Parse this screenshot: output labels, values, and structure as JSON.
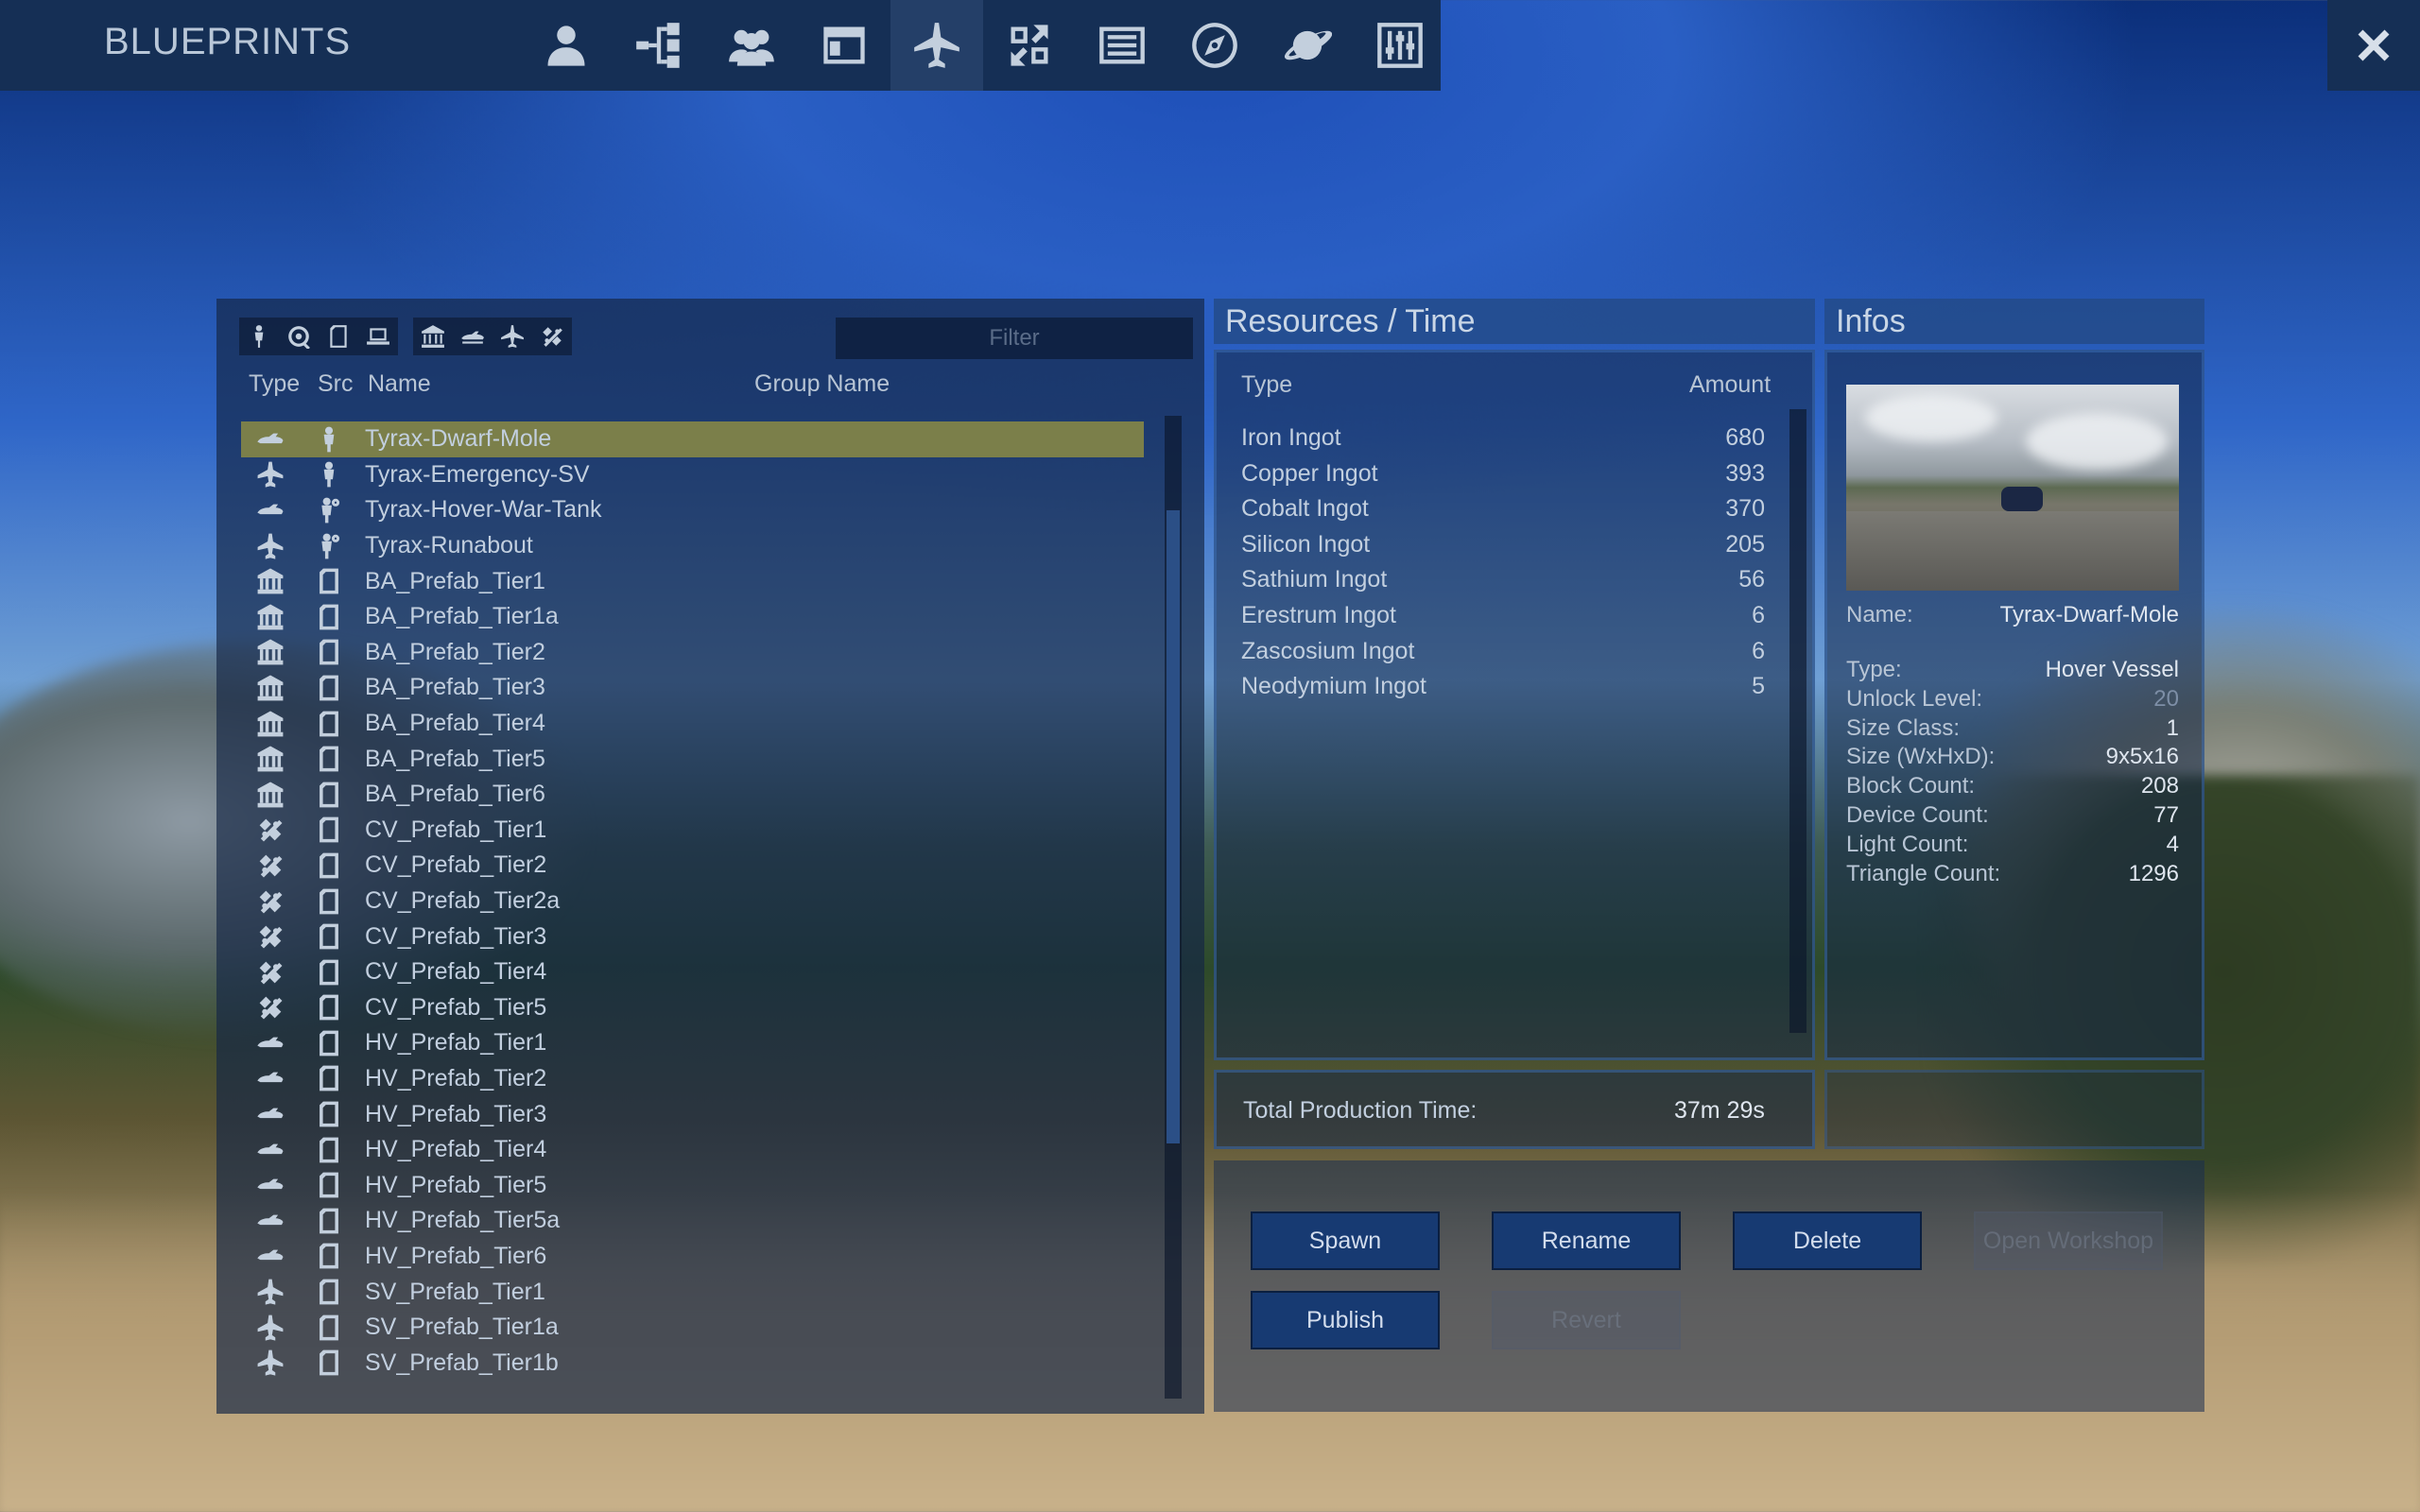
{
  "app": {
    "title": "BLUEPRINTS"
  },
  "nav": [
    {
      "icon": "player-icon",
      "active": false
    },
    {
      "icon": "tech-tree-icon",
      "active": false
    },
    {
      "icon": "faction-icon",
      "active": false
    },
    {
      "icon": "window-icon",
      "active": false
    },
    {
      "icon": "blueprint-ship-icon",
      "active": true
    },
    {
      "icon": "exchange-icon",
      "active": false
    },
    {
      "icon": "list-icon",
      "active": false
    },
    {
      "icon": "compass-icon",
      "active": false
    },
    {
      "icon": "planet-icon",
      "active": false
    },
    {
      "icon": "settings-sliders-icon",
      "active": false
    }
  ],
  "filter": {
    "placeholder": "Filter",
    "icon_group_src": [
      "player-src-icon",
      "workshop-src-icon",
      "file-src-icon",
      "local-src-icon"
    ],
    "icon_group_type": [
      "base-icon",
      "hover-vessel-icon",
      "small-vessel-icon",
      "capital-vessel-icon"
    ]
  },
  "list": {
    "headers": {
      "type": "Type",
      "src": "Src",
      "name": "Name",
      "group": "Group Name"
    },
    "rows": [
      {
        "type": "hover-vessel-icon",
        "src": "player-src-icon",
        "name": "Tyrax-Dwarf-Mole",
        "selected": true
      },
      {
        "type": "small-vessel-icon",
        "src": "player-src-icon",
        "name": "Tyrax-Emergency-SV",
        "selected": false
      },
      {
        "type": "hover-vessel-icon",
        "src": "workshop-src-icon",
        "name": "Tyrax-Hover-War-Tank",
        "selected": false
      },
      {
        "type": "small-vessel-icon",
        "src": "workshop-src-icon",
        "name": "Tyrax-Runabout",
        "selected": false
      },
      {
        "type": "base-icon",
        "src": "file-src-icon",
        "name": "BA_Prefab_Tier1",
        "selected": false
      },
      {
        "type": "base-icon",
        "src": "file-src-icon",
        "name": "BA_Prefab_Tier1a",
        "selected": false
      },
      {
        "type": "base-icon",
        "src": "file-src-icon",
        "name": "BA_Prefab_Tier2",
        "selected": false
      },
      {
        "type": "base-icon",
        "src": "file-src-icon",
        "name": "BA_Prefab_Tier3",
        "selected": false
      },
      {
        "type": "base-icon",
        "src": "file-src-icon",
        "name": "BA_Prefab_Tier4",
        "selected": false
      },
      {
        "type": "base-icon",
        "src": "file-src-icon",
        "name": "BA_Prefab_Tier5",
        "selected": false
      },
      {
        "type": "base-icon",
        "src": "file-src-icon",
        "name": "BA_Prefab_Tier6",
        "selected": false
      },
      {
        "type": "capital-vessel-icon",
        "src": "file-src-icon",
        "name": "CV_Prefab_Tier1",
        "selected": false
      },
      {
        "type": "capital-vessel-icon",
        "src": "file-src-icon",
        "name": "CV_Prefab_Tier2",
        "selected": false
      },
      {
        "type": "capital-vessel-icon",
        "src": "file-src-icon",
        "name": "CV_Prefab_Tier2a",
        "selected": false
      },
      {
        "type": "capital-vessel-icon",
        "src": "file-src-icon",
        "name": "CV_Prefab_Tier3",
        "selected": false
      },
      {
        "type": "capital-vessel-icon",
        "src": "file-src-icon",
        "name": "CV_Prefab_Tier4",
        "selected": false
      },
      {
        "type": "capital-vessel-icon",
        "src": "file-src-icon",
        "name": "CV_Prefab_Tier5",
        "selected": false
      },
      {
        "type": "hover-vessel-icon",
        "src": "file-src-icon",
        "name": "HV_Prefab_Tier1",
        "selected": false
      },
      {
        "type": "hover-vessel-icon",
        "src": "file-src-icon",
        "name": "HV_Prefab_Tier2",
        "selected": false
      },
      {
        "type": "hover-vessel-icon",
        "src": "file-src-icon",
        "name": "HV_Prefab_Tier3",
        "selected": false
      },
      {
        "type": "hover-vessel-icon",
        "src": "file-src-icon",
        "name": "HV_Prefab_Tier4",
        "selected": false
      },
      {
        "type": "hover-vessel-icon",
        "src": "file-src-icon",
        "name": "HV_Prefab_Tier5",
        "selected": false
      },
      {
        "type": "hover-vessel-icon",
        "src": "file-src-icon",
        "name": "HV_Prefab_Tier5a",
        "selected": false
      },
      {
        "type": "hover-vessel-icon",
        "src": "file-src-icon",
        "name": "HV_Prefab_Tier6",
        "selected": false
      },
      {
        "type": "small-vessel-icon",
        "src": "file-src-icon",
        "name": "SV_Prefab_Tier1",
        "selected": false
      },
      {
        "type": "small-vessel-icon",
        "src": "file-src-icon",
        "name": "SV_Prefab_Tier1a",
        "selected": false
      },
      {
        "type": "small-vessel-icon",
        "src": "file-src-icon",
        "name": "SV_Prefab_Tier1b",
        "selected": false
      }
    ]
  },
  "resources": {
    "title": "Resources / Time",
    "type_header": "Type",
    "amount_header": "Amount",
    "items": [
      {
        "type": "Iron Ingot",
        "amount": "680"
      },
      {
        "type": "Copper Ingot",
        "amount": "393"
      },
      {
        "type": "Cobalt Ingot",
        "amount": "370"
      },
      {
        "type": "Silicon Ingot",
        "amount": "205"
      },
      {
        "type": "Sathium Ingot",
        "amount": "56"
      },
      {
        "type": "Erestrum Ingot",
        "amount": "6"
      },
      {
        "type": "Zascosium Ingot",
        "amount": "6"
      },
      {
        "type": "Neodymium Ingot",
        "amount": "5"
      }
    ],
    "production_label": "Total Production Time:",
    "production_value": "37m 29s"
  },
  "infos": {
    "title": "Infos",
    "name_label": "Name:",
    "name_value": "Tyrax-Dwarf-Mole",
    "fields": [
      {
        "label": "Type:",
        "value": "Hover Vessel",
        "dim": false
      },
      {
        "label": "Unlock Level:",
        "value": "20",
        "dim": true
      },
      {
        "label": "Size Class:",
        "value": "1",
        "dim": false
      },
      {
        "label": "Size (WxHxD):",
        "value": "9x5x16",
        "dim": false
      },
      {
        "label": "Block Count:",
        "value": "208",
        "dim": false
      },
      {
        "label": "Device Count:",
        "value": "77",
        "dim": false
      },
      {
        "label": "Light Count:",
        "value": "4",
        "dim": false
      },
      {
        "label": "Triangle Count:",
        "value": "1296",
        "dim": false
      }
    ]
  },
  "actions": {
    "spawn": "Spawn",
    "rename": "Rename",
    "delete": "Delete",
    "open_workshop": "Open Workshop",
    "publish": "Publish",
    "revert": "Revert"
  },
  "colors": {
    "topbar": "#152f55",
    "nav_active": "#243f68",
    "selected_row": "#7b7f4a",
    "button": "#173a72"
  }
}
